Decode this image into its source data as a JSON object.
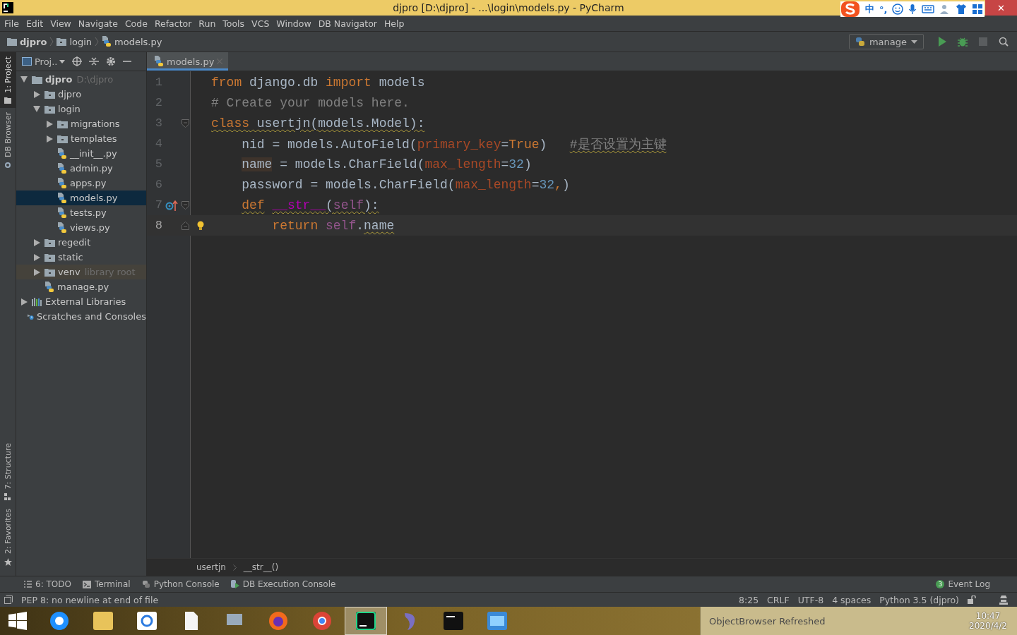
{
  "window": {
    "title": "djpro [D:\\djpro] - ...\\login\\models.py - PyCharm",
    "close": "✕"
  },
  "ime_bar": {
    "language": "中",
    "punct": "°,"
  },
  "menu": [
    "File",
    "Edit",
    "View",
    "Navigate",
    "Code",
    "Refactor",
    "Run",
    "Tools",
    "VCS",
    "Window",
    "DB Navigator",
    "Help"
  ],
  "nav_path": [
    {
      "label": "djpro",
      "kind": "project"
    },
    {
      "label": "login",
      "kind": "folder"
    },
    {
      "label": "models.py",
      "kind": "pyfile"
    }
  ],
  "run_config": "manage",
  "left_stripe": [
    {
      "label": "1: Project",
      "selected": true,
      "kind": "folder"
    },
    {
      "label": "DB Browser",
      "selected": false,
      "kind": "db"
    },
    {
      "label": "7: Structure",
      "selected": false,
      "kind": "structure"
    },
    {
      "label": "2: Favorites",
      "selected": false,
      "kind": "star"
    }
  ],
  "project_panel": {
    "title": "Proj.."
  },
  "project_tree": [
    {
      "label": "djpro",
      "hint": "D:\\djpro",
      "kind": "project",
      "expanded": true,
      "selected": false,
      "children": [
        {
          "label": "djpro",
          "kind": "folder",
          "expanded": false,
          "selected": false
        },
        {
          "label": "login",
          "kind": "folder",
          "expanded": true,
          "selected": false,
          "children": [
            {
              "label": "migrations",
              "kind": "folder",
              "expanded": false,
              "selected": false
            },
            {
              "label": "templates",
              "kind": "folder",
              "expanded": false,
              "selected": false
            },
            {
              "label": "__init__.py",
              "kind": "pyfile",
              "selected": false
            },
            {
              "label": "admin.py",
              "kind": "pyfile",
              "selected": false
            },
            {
              "label": "apps.py",
              "kind": "pyfile",
              "selected": false
            },
            {
              "label": "models.py",
              "kind": "pyfile",
              "selected": true
            },
            {
              "label": "tests.py",
              "kind": "pyfile",
              "selected": false
            },
            {
              "label": "views.py",
              "kind": "pyfile",
              "selected": false
            }
          ]
        },
        {
          "label": "regedit",
          "kind": "folder",
          "expanded": false,
          "selected": false
        },
        {
          "label": "static",
          "kind": "folder",
          "expanded": false,
          "selected": false
        },
        {
          "label": "venv",
          "hint": "library root",
          "kind": "libfolder",
          "expanded": false,
          "selected": false
        },
        {
          "label": "manage.py",
          "kind": "pyfile",
          "selected": false
        }
      ]
    },
    {
      "label": "External Libraries",
      "kind": "library",
      "expanded": false,
      "selected": false
    },
    {
      "label": "Scratches and Consoles",
      "kind": "scratches",
      "selected": false
    }
  ],
  "editor_tabs": [
    {
      "label": "models.py",
      "selected": true
    }
  ],
  "code_lines": [
    {
      "number": "1",
      "current": false,
      "fold_start": false,
      "fold_end": false,
      "override_marker": false,
      "bulb": false,
      "tokens": [
        {
          "text": "from",
          "kind": "kw"
        },
        {
          "text": " django.db ",
          "kind": "plain"
        },
        {
          "text": "import",
          "kind": "kw"
        },
        {
          "text": " models",
          "kind": "plain"
        }
      ]
    },
    {
      "number": "2",
      "current": false,
      "fold_start": false,
      "fold_end": false,
      "override_marker": false,
      "bulb": false,
      "tokens": [
        {
          "text": "# Create your models here.",
          "kind": "comment"
        }
      ]
    },
    {
      "number": "3",
      "current": false,
      "fold_start": true,
      "fold_end": false,
      "override_marker": false,
      "bulb": false,
      "tokens": [
        {
          "text": "class",
          "kind": "kw",
          "wavy": true
        },
        {
          "text": " usertjn(models.Model):",
          "kind": "plain",
          "wavy": true
        }
      ],
      "children": [
        {
          "number": "4",
          "current": false,
          "fold_start": false,
          "fold_end": false,
          "override_marker": false,
          "bulb": false,
          "tokens": [
            {
              "text": "nid = models.AutoField(",
              "kind": "plain"
            },
            {
              "text": "primary_key",
              "kind": "param"
            },
            {
              "text": "=",
              "kind": "plain"
            },
            {
              "text": "True",
              "kind": "kw"
            },
            {
              "text": ")",
              "kind": "plain"
            },
            {
              "text": "#是否设置为主键",
              "kind": "comment",
              "wavy": true
            }
          ]
        },
        {
          "number": "5",
          "current": false,
          "fold_start": false,
          "fold_end": false,
          "override_marker": false,
          "bulb": false,
          "tokens": [
            {
              "text": "name",
              "kind": "plain",
              "highlight": true
            },
            {
              "text": " = models.CharField(",
              "kind": "plain"
            },
            {
              "text": "max_length",
              "kind": "param"
            },
            {
              "text": "=",
              "kind": "plain"
            },
            {
              "text": "32",
              "kind": "num"
            },
            {
              "text": ")",
              "kind": "plain"
            }
          ]
        },
        {
          "number": "6",
          "current": false,
          "fold_start": false,
          "fold_end": false,
          "override_marker": false,
          "bulb": false,
          "tokens": [
            {
              "text": "password = models.CharField(",
              "kind": "plain"
            },
            {
              "text": "max_length",
              "kind": "param"
            },
            {
              "text": "=",
              "kind": "plain"
            },
            {
              "text": "32",
              "kind": "num"
            },
            {
              "text": ",",
              "kind": "kw"
            },
            {
              "text": ")",
              "kind": "plain"
            }
          ]
        },
        {
          "number": "7",
          "current": false,
          "fold_start": true,
          "fold_end": false,
          "override_marker": true,
          "bulb": false,
          "tokens": [
            {
              "text": "def",
              "kind": "kw",
              "wavy": true
            },
            {
              "text": "__str__",
              "kind": "magic",
              "wavy": true
            },
            {
              "text": "(",
              "kind": "plain",
              "wavy": true
            },
            {
              "text": "self",
              "kind": "self",
              "wavy": true
            },
            {
              "text": "):",
              "kind": "plain",
              "wavy": true
            }
          ],
          "children": [
            {
              "number": "8",
              "current": true,
              "fold_start": false,
              "fold_end": true,
              "override_marker": false,
              "bulb": true,
              "tokens": [
                {
                  "text": "return",
                  "kind": "kw"
                },
                {
                  "text": "self",
                  "kind": "self"
                },
                {
                  "text": ".",
                  "kind": "plain"
                },
                {
                  "text": "name",
                  "kind": "plain",
                  "wavy": true
                }
              ]
            }
          ]
        }
      ]
    }
  ],
  "breadcrumb": [
    "usertjn",
    "__str__()"
  ],
  "tool_tabs": [
    {
      "label": "6: TODO",
      "kind": "todo"
    },
    {
      "label": "Terminal",
      "kind": "terminal"
    },
    {
      "label": "Python Console",
      "kind": "python"
    },
    {
      "label": "DB Execution Console",
      "kind": "db"
    }
  ],
  "event_log": {
    "label": "Event Log",
    "count": "3"
  },
  "status_bar": {
    "message": "PEP 8: no newline at end of file",
    "items": [
      "8:25",
      "CRLF",
      "UTF-8",
      "4 spaces",
      "Python 3.5 (djpro)"
    ]
  },
  "taskbar": {
    "apps": [
      {
        "kind": "ie",
        "selected": false
      },
      {
        "kind": "explorer",
        "selected": false
      },
      {
        "kind": "baidu",
        "selected": false
      },
      {
        "kind": "file",
        "selected": false
      },
      {
        "kind": "monitor",
        "selected": false
      },
      {
        "kind": "firefox",
        "selected": false
      },
      {
        "kind": "chrome",
        "selected": false
      },
      {
        "kind": "pycharm",
        "selected": true
      },
      {
        "kind": "dolphin",
        "selected": false
      },
      {
        "kind": "cmd",
        "selected": false
      },
      {
        "kind": "photos",
        "selected": false
      }
    ],
    "notification": "ObjectBrowser Refreshed",
    "time": "10:47",
    "date": "2020/4/2"
  }
}
